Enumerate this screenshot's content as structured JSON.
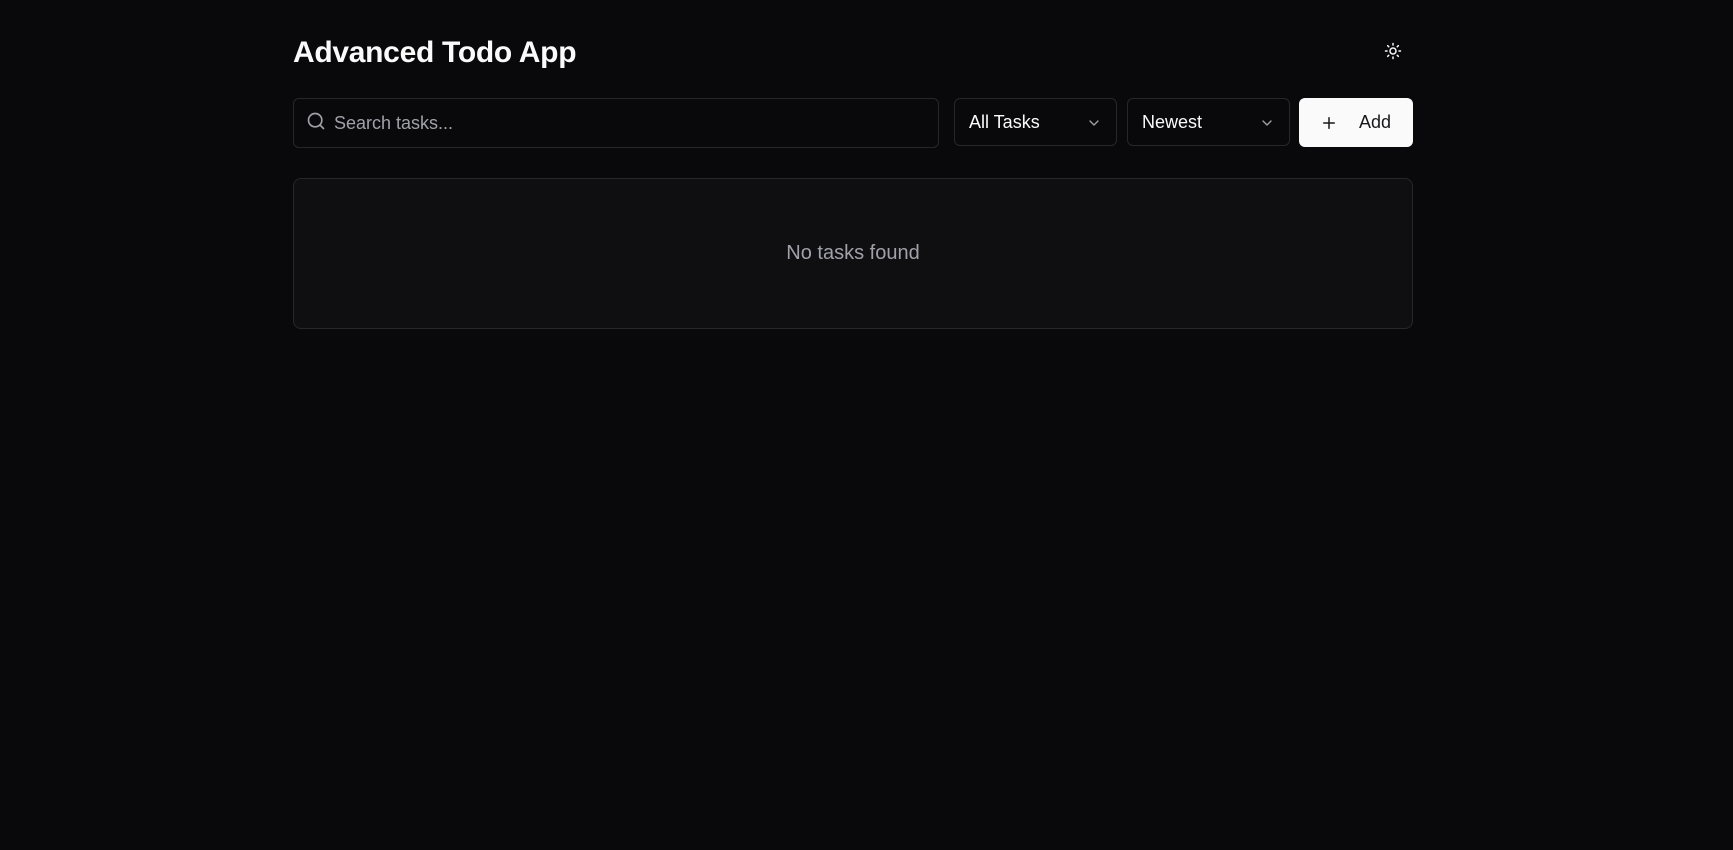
{
  "app": {
    "title": "Advanced Todo App"
  },
  "header": {
    "theme_toggle_icon": "sun-icon"
  },
  "toolbar": {
    "search": {
      "placeholder": "Search tasks...",
      "value": "",
      "icon": "search-icon"
    },
    "filter": {
      "selected": "All Tasks",
      "icon": "chevron-down-icon"
    },
    "sort": {
      "selected": "Newest",
      "icon": "chevron-down-icon"
    },
    "add_button": {
      "label": "Add",
      "icon": "plus-icon"
    }
  },
  "task_list": {
    "empty_message": "No tasks found"
  },
  "colors": {
    "background": "#09090b",
    "border": "#27272a",
    "foreground": "#fafafa",
    "muted": "#a1a1aa",
    "primary_button_bg": "#fafafa",
    "primary_button_text": "#18181b"
  }
}
